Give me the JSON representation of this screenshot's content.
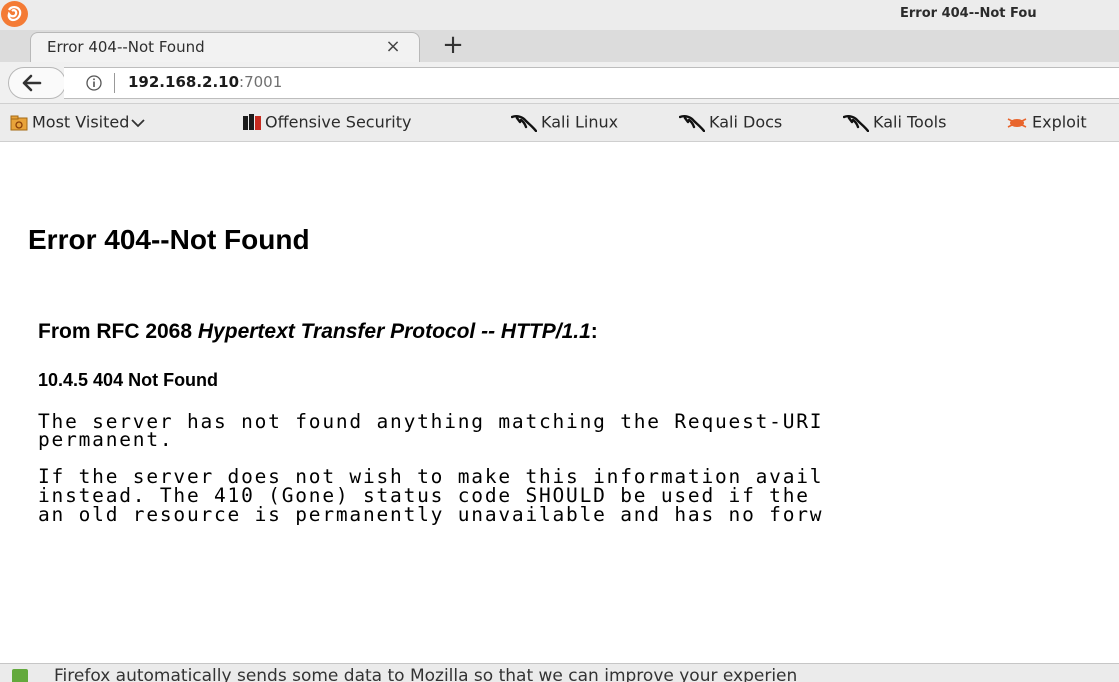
{
  "window": {
    "title": "Error 404--Not Fou"
  },
  "tabs": [
    {
      "label": "Error 404--Not Found",
      "close": "×"
    }
  ],
  "new_tab_label": "+",
  "navbar": {
    "url_host": "192.168.2.10",
    "url_port": ":7001",
    "icons": [
      "back-arrow-icon",
      "info-icon"
    ]
  },
  "bookmarks": [
    {
      "label": "Most Visited",
      "icon": "folder-icon"
    },
    {
      "label": "Offensive Security",
      "icon": "offsec-icon"
    },
    {
      "label": "Kali Linux",
      "icon": "kali-dragon-icon"
    },
    {
      "label": "Kali Docs",
      "icon": "kali-dragon-icon"
    },
    {
      "label": "Kali Tools",
      "icon": "kali-dragon-icon"
    },
    {
      "label": "Exploit",
      "icon": "exploit-db-icon"
    }
  ],
  "page": {
    "heading": "Error 404--Not Found",
    "rfc_prefix": "From RFC 2068 ",
    "rfc_title": "Hypertext Transfer Protocol -- HTTP/1.1",
    "rfc_suffix": ":",
    "section_heading": "10.4.5 404 Not Found",
    "para1_line1": "The server has not found anything matching the Request-URI",
    "para1_line2": "permanent.",
    "para2_line1": "If the server does not wish to make this information avail",
    "para2_line2": "instead. The 410 (Gone) status code SHOULD be used if the",
    "para2_line3": "an old resource is permanently unavailable and has no forw"
  },
  "notification": {
    "text": "Firefox automatically sends some data to Mozilla so that we can improve your experien"
  },
  "colors": {
    "firefox_orange": "#f47b35",
    "notification_green": "#63a93c",
    "exploit_orange": "#e8652d"
  }
}
